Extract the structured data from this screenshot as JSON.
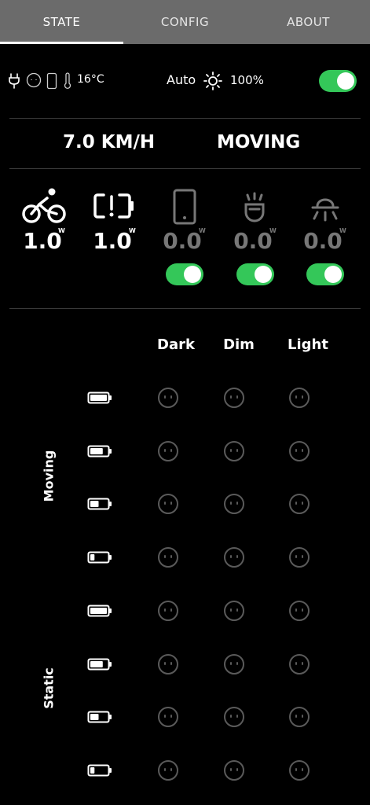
{
  "tabs": [
    {
      "label": "STATE",
      "active": true
    },
    {
      "label": "CONFIG",
      "active": false
    },
    {
      "label": "ABOUT",
      "active": false
    }
  ],
  "status": {
    "temperature": "16°C",
    "auto_label": "Auto",
    "brightness": "100%",
    "auto_toggle_on": true
  },
  "motion": {
    "speed": "7.0 KM/H",
    "state": "MOVING"
  },
  "power": {
    "unit": "W",
    "items": [
      {
        "icon": "bicycle-icon",
        "value": "1.0",
        "dimmed": false,
        "toggle": null
      },
      {
        "icon": "battery-alert-icon",
        "value": "1.0",
        "dimmed": false,
        "toggle": null
      },
      {
        "icon": "phone-icon",
        "value": "0.0",
        "dimmed": true,
        "toggle": true
      },
      {
        "icon": "front-light-icon",
        "value": "0.0",
        "dimmed": true,
        "toggle": true
      },
      {
        "icon": "rear-light-icon",
        "value": "0.0",
        "dimmed": true,
        "toggle": true
      }
    ]
  },
  "matrix": {
    "columns": [
      "Dark",
      "Dim",
      "Light"
    ],
    "groups": [
      {
        "label": "Moving",
        "battery_levels": [
          1.0,
          0.75,
          0.5,
          0.25
        ]
      },
      {
        "label": "Static",
        "battery_levels": [
          1.0,
          0.75,
          0.5,
          0.25
        ]
      }
    ]
  },
  "colors": {
    "toggle_on": "#34c759",
    "tabbar": "#6b6b6b",
    "dimmed": "#777777"
  }
}
